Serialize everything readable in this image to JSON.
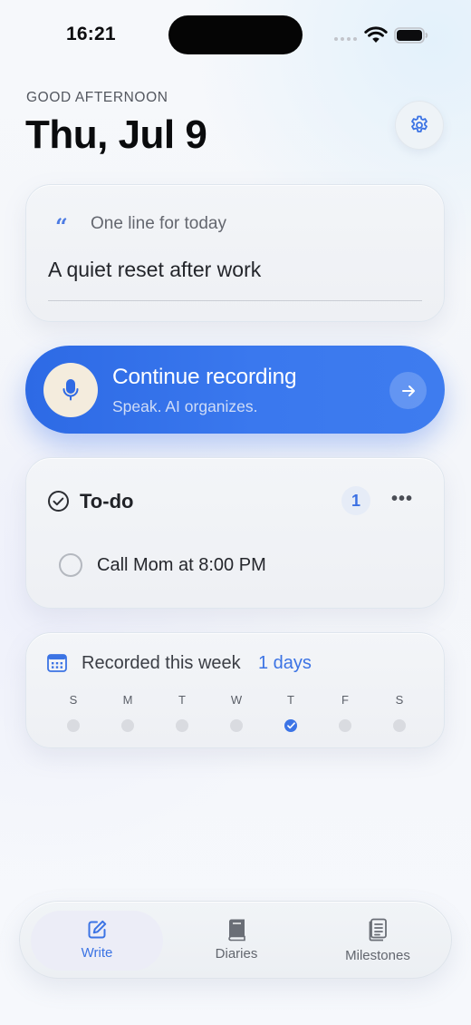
{
  "status_bar": {
    "time": "16:21"
  },
  "header": {
    "greeting": "GOOD AFTERNOON",
    "date": "Thu, Jul 9"
  },
  "quote_card": {
    "label": "One line for today",
    "text": "A quiet reset after work"
  },
  "record_button": {
    "title": "Continue recording",
    "subtitle": "Speak. AI organizes."
  },
  "todo": {
    "title": "To-do",
    "count": "1",
    "items": [
      {
        "text": "Call Mom at 8:00 PM",
        "done": false
      }
    ]
  },
  "week": {
    "label": "Recorded this week",
    "count": "1 days",
    "days": [
      {
        "letter": "S",
        "recorded": false
      },
      {
        "letter": "M",
        "recorded": false
      },
      {
        "letter": "T",
        "recorded": false
      },
      {
        "letter": "W",
        "recorded": false
      },
      {
        "letter": "T",
        "recorded": true
      },
      {
        "letter": "F",
        "recorded": false
      },
      {
        "letter": "S",
        "recorded": false
      }
    ]
  },
  "tabs": [
    {
      "label": "Write",
      "icon": "edit-icon",
      "active": true
    },
    {
      "label": "Diaries",
      "icon": "book-icon",
      "active": false
    },
    {
      "label": "Milestones",
      "icon": "milestones-icon",
      "active": false
    }
  ],
  "colors": {
    "accent": "#3b73e4",
    "record_button": "#3470e8"
  }
}
